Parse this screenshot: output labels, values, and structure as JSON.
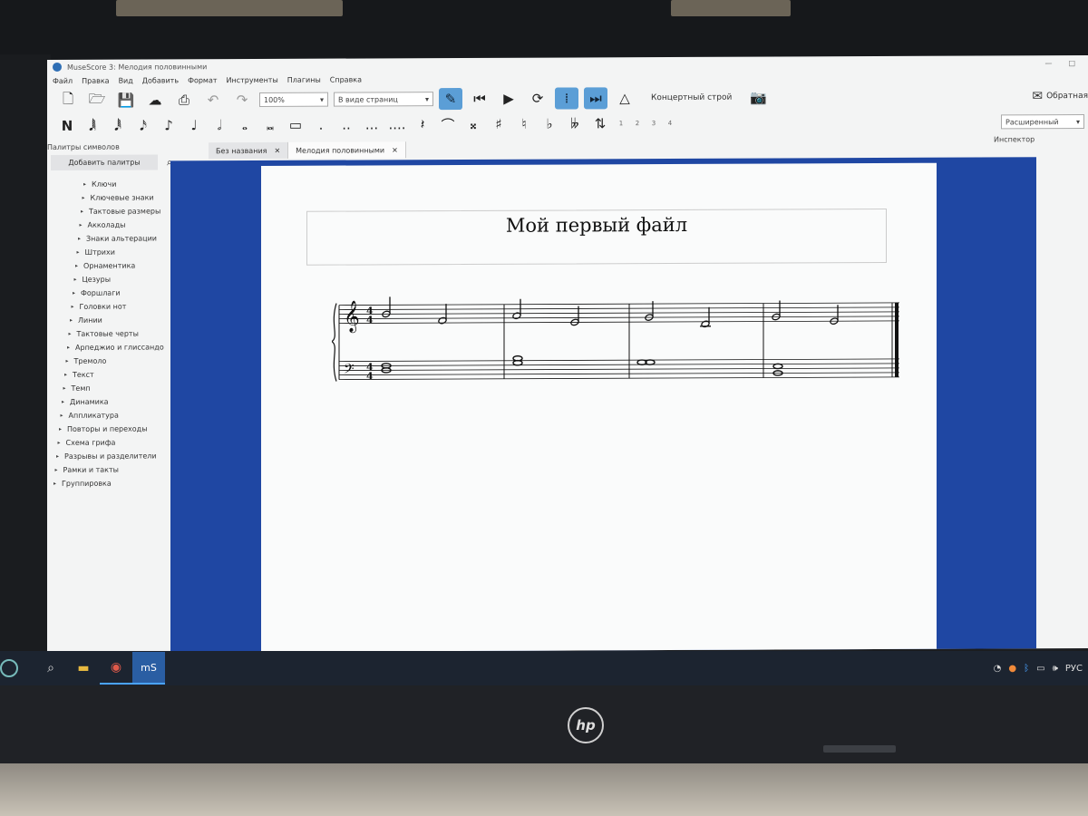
{
  "window": {
    "title": "MuseScore 3: Мелодия половинными"
  },
  "menu": [
    "Файл",
    "Правка",
    "Вид",
    "Добавить",
    "Формат",
    "Инструменты",
    "Плагины",
    "Справка"
  ],
  "toolbar": {
    "zoom_value": "100%",
    "view_mode": "В виде страниц",
    "concert_pitch": "Концертный строй",
    "feedback": "Обратная"
  },
  "note_input": {
    "voices": [
      "1",
      "2",
      "3",
      "4"
    ],
    "workspace": "Расширенный"
  },
  "palette": {
    "title": "Палитры символов",
    "add_button": "Добавить палитры",
    "items": [
      "Ключи",
      "Ключевые знаки",
      "Тактовые размеры",
      "Акколады",
      "Знаки альтерации",
      "Штрихи",
      "Орнаментика",
      "Цезуры",
      "Форшлаги",
      "Головки нот",
      "Линии",
      "Тактовые черты",
      "Арпеджио и глиссандо",
      "Тремоло",
      "Текст",
      "Темп",
      "Динамика",
      "Аппликатура",
      "Повторы и переходы",
      "Схема грифа",
      "Разрывы и разделители",
      "Рамки и такты",
      "Группировка"
    ]
  },
  "tabs": [
    {
      "label": "Без названия",
      "close": "✕"
    },
    {
      "label": "Мелодия половинными",
      "close": "✕"
    }
  ],
  "score": {
    "title": "Мой первый файл",
    "time_signature": "4/4"
  },
  "inspector": {
    "title": "Инспектор"
  },
  "taskbar": {
    "language": "РУС"
  },
  "colors": {
    "score_background": "#1f47a3",
    "accent": "#5b9ed6",
    "taskbar": "#1c2430"
  }
}
